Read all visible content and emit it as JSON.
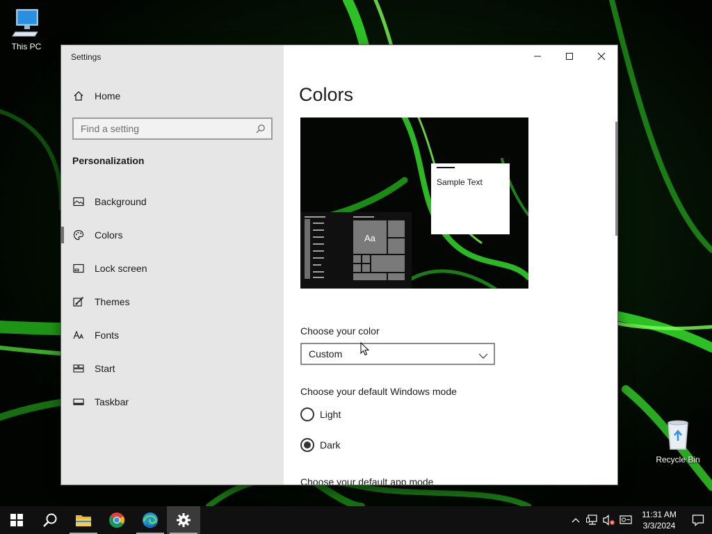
{
  "desktop": {
    "icons": [
      {
        "label": "This PC"
      },
      {
        "label": "Recycle Bin"
      }
    ]
  },
  "settings": {
    "window_title": "Settings",
    "home_label": "Home",
    "search_placeholder": "Find a setting",
    "section_header": "Personalization",
    "nav_items": [
      {
        "label": "Background",
        "icon": "picture-icon",
        "selected": false
      },
      {
        "label": "Colors",
        "icon": "palette-icon",
        "selected": true
      },
      {
        "label": "Lock screen",
        "icon": "lock-screen-icon",
        "selected": false
      },
      {
        "label": "Themes",
        "icon": "brush-icon",
        "selected": false
      },
      {
        "label": "Fonts",
        "icon": "font-icon",
        "selected": false
      },
      {
        "label": "Start",
        "icon": "start-tiles-icon",
        "selected": false
      },
      {
        "label": "Taskbar",
        "icon": "taskbar-icon",
        "selected": false
      }
    ],
    "content": {
      "title": "Colors",
      "preview_sample_text": "Sample Text",
      "preview_tile_label": "Aa",
      "choose_color_label": "Choose your color",
      "choose_color_value": "Custom",
      "windows_mode_label": "Choose your default Windows mode",
      "mode_options": [
        {
          "label": "Light",
          "checked": false
        },
        {
          "label": "Dark",
          "checked": true
        }
      ],
      "app_mode_label": "Choose your default app mode"
    }
  },
  "taskbar": {
    "apps": [
      {
        "name": "start-button",
        "icon": "windows-logo-icon"
      },
      {
        "name": "search-button",
        "icon": "search-icon"
      },
      {
        "name": "file-explorer",
        "icon": "folder-icon"
      },
      {
        "name": "chrome",
        "icon": "chrome-icon"
      },
      {
        "name": "edge",
        "icon": "edge-icon"
      },
      {
        "name": "settings",
        "icon": "gear-icon"
      }
    ],
    "clock_time": "11:31 AM",
    "clock_date": "3/3/2024"
  },
  "colors": {
    "accent_green": "#2fd42a",
    "sidebar_bg": "#e6e6e6",
    "taskbar_bg": "#101010"
  }
}
